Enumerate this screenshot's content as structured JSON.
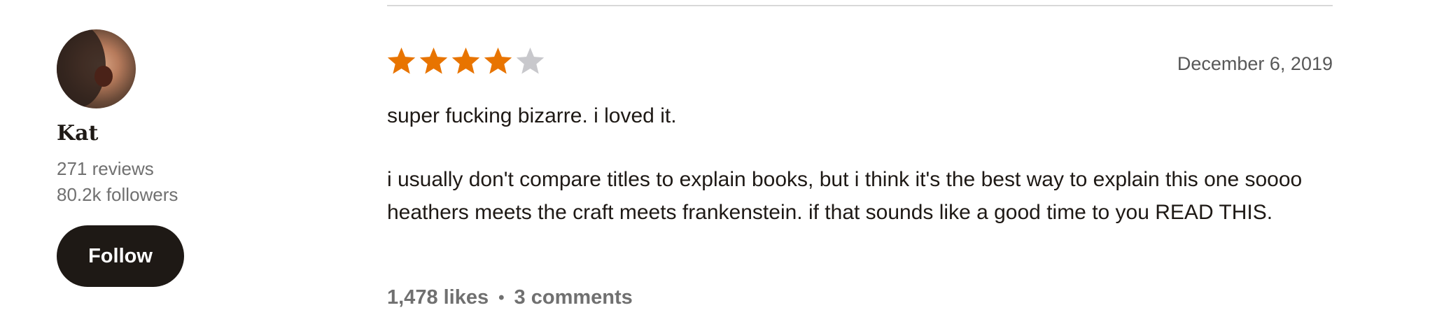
{
  "reviewer": {
    "name": "Kat",
    "reviews": "271 reviews",
    "followers": "80.2k followers",
    "follow_label": "Follow"
  },
  "review": {
    "rating": 4,
    "max_rating": 5,
    "date": "December 6, 2019",
    "paragraph_1": "super fucking bizarre. i loved it.",
    "paragraph_2": "i usually don't compare titles to explain books, but i think it's the best way to explain this one soooo",
    "paragraph_3": "heathers meets the craft meets frankenstein. if that sounds like a good time to you READ THIS.",
    "likes": "1,478 likes",
    "separator": "•",
    "comments": "3 comments"
  },
  "colors": {
    "star_filled": "#e87400",
    "star_empty": "#c8c8cc",
    "follow_bg": "#1e1915"
  },
  "icons": {
    "star": "star-icon"
  }
}
